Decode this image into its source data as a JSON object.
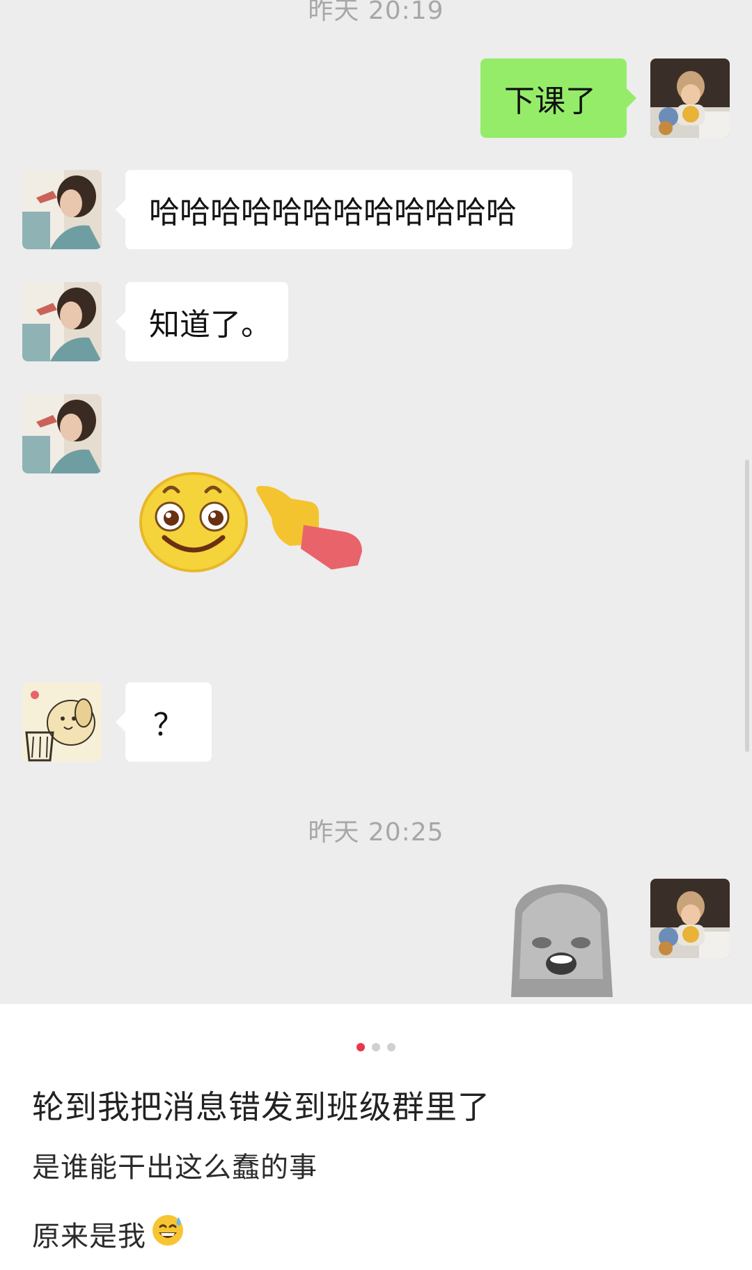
{
  "theme": {
    "chat_bg": "#ededed",
    "sent_bubble": "#95ec69",
    "received_bubble": "#ffffff",
    "timestamp_color": "#a7a7a7",
    "active_dot": "#e8364a",
    "inactive_dot": "#d0d0d0"
  },
  "chat": {
    "timestamp_top": "昨天 20:19",
    "messages": [
      {
        "side": "right",
        "kind": "text",
        "text": "下课了",
        "avatar": "user-avatar-child"
      },
      {
        "side": "left",
        "kind": "text",
        "text": "哈哈哈哈哈哈哈哈哈哈哈哈",
        "avatar": "friend-avatar-girl"
      },
      {
        "side": "left",
        "kind": "text",
        "text": "知道了。",
        "avatar": "friend-avatar-girl"
      },
      {
        "side": "left",
        "kind": "sticker",
        "sticker": "smile-point-emoji",
        "avatar": "friend-avatar-girl"
      },
      {
        "side": "left",
        "kind": "text",
        "text": "？",
        "avatar": "friend-avatar-dog"
      }
    ],
    "timestamp_mid": "昨天 20:25",
    "last": {
      "side": "right",
      "kind": "sticker",
      "sticker": "laughing-cat-sticker",
      "avatar": "user-avatar-child"
    }
  },
  "post": {
    "page_dots": {
      "count": 3,
      "active_index": 0
    },
    "title": "轮到我把消息错发到班级群里了",
    "line1": "是谁能干出这么蠢的事",
    "line2": "原来是我",
    "line2_emoji": "sweat-smile-emoji"
  }
}
